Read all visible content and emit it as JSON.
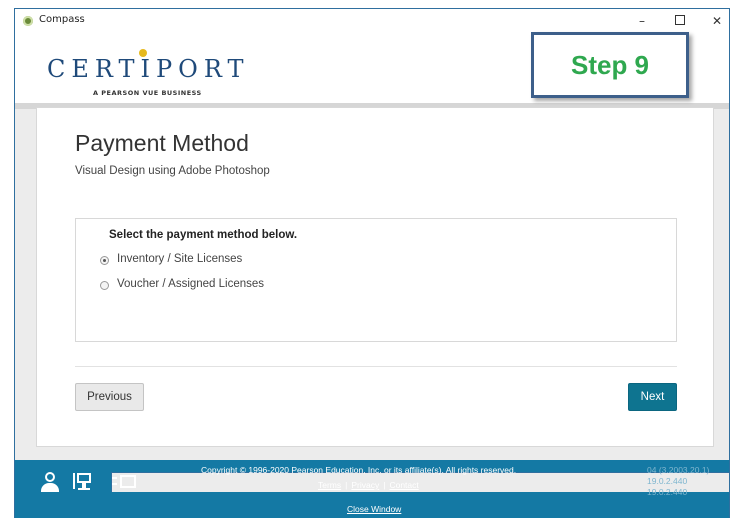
{
  "window": {
    "title": "Compass",
    "minimize": "–",
    "close": "✕"
  },
  "logo": {
    "brand": "CERTIPORT",
    "tagline": "A PEARSON VUE BUSINESS"
  },
  "step_badge": "Step 9",
  "page": {
    "title": "Payment Method",
    "subtitle": "Visual Design using Adobe Photoshop"
  },
  "payment": {
    "heading": "Select the payment method below.",
    "options": [
      {
        "label": "Inventory / Site Licenses",
        "selected": true
      },
      {
        "label": "Voucher / Assigned Licenses",
        "selected": false
      }
    ]
  },
  "buttons": {
    "previous": "Previous",
    "next": "Next"
  },
  "footer": {
    "icons": [
      "user-support-icon",
      "desktop-icon",
      "window-icon"
    ],
    "copyright": "Copyright © 1996-2020 Pearson Education, Inc. or its affiliate(s). All rights reserved.",
    "links": {
      "terms": "Terms",
      "privacy": "Privacy",
      "contact": "Contact",
      "separator": "|"
    },
    "close_window": "Close Window",
    "version_lines": [
      "04 (3.2003.20.1)",
      "19.0.2.440",
      "19.0.2.440"
    ]
  },
  "colors": {
    "accent": "#1479a4",
    "next_button": "#0e7490",
    "step_text": "#2fa84f"
  }
}
